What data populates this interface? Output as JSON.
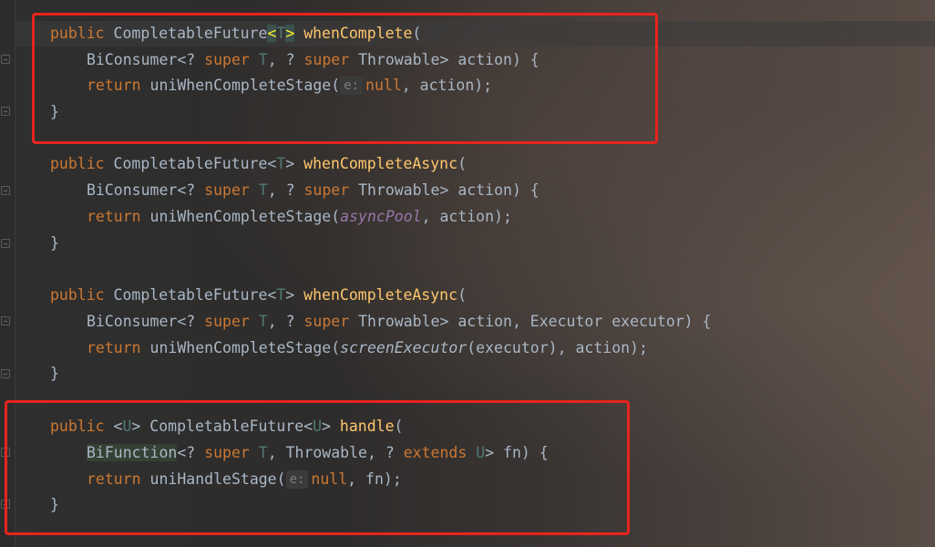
{
  "code": {
    "block1": {
      "sig_kw": "public",
      "sig_type": "CompletableFuture",
      "sig_lt": "<",
      "sig_t": "T",
      "sig_gt": ">",
      "sig_name": "whenComplete",
      "sig_paren": "(",
      "p_type": "BiConsumer<?",
      "p_super1": "super",
      "p_t": "T",
      "p_comma": ", ?",
      "p_super2": "super",
      "p_rest": "Throwable> action) {",
      "ret_kw": "return",
      "ret_call": "uniWhenCompleteStage(",
      "ret_hint": "e:",
      "ret_null": "null",
      "ret_tail": ", action);",
      "close": "}"
    },
    "block2": {
      "sig_kw": "public",
      "sig_type": "CompletableFuture<",
      "sig_t": "T",
      "sig_gt": ">",
      "sig_name": "whenCompleteAsync",
      "sig_paren": "(",
      "p_type": "BiConsumer<?",
      "p_super1": "super",
      "p_t": "T",
      "p_comma": ", ?",
      "p_super2": "super",
      "p_rest": "Throwable> action) {",
      "ret_kw": "return",
      "ret_call": "uniWhenCompleteStage(",
      "ret_arg": "asyncPool",
      "ret_tail": ", action);",
      "close": "}"
    },
    "block3": {
      "sig_kw": "public",
      "sig_type": "CompletableFuture<",
      "sig_t": "T",
      "sig_gt": ">",
      "sig_name": "whenCompleteAsync",
      "sig_paren": "(",
      "p_type": "BiConsumer<?",
      "p_super1": "super",
      "p_t": "T",
      "p_comma": ", ?",
      "p_super2": "super",
      "p_rest": "Throwable> action, Executor executor) {",
      "ret_kw": "return",
      "ret_call": "uniWhenCompleteStage(",
      "ret_arg": "screenExecutor",
      "ret_tail": "(executor), action);",
      "close": "}"
    },
    "block4": {
      "sig_kw": "public",
      "sig_lt": "<",
      "sig_u": "U",
      "sig_gt": ">",
      "sig_type": "CompletableFuture<",
      "sig_u2": "U",
      "sig_gt2": ">",
      "sig_name": "handle",
      "sig_paren": "(",
      "p_type": "BiFunction",
      "p_open": "<?",
      "p_super": "super",
      "p_t": "T",
      "p_mid": ", Throwable, ?",
      "p_extends": "extends",
      "p_u": "U",
      "p_rest": "> fn) {",
      "ret_kw": "return",
      "ret_call": "uniHandleStage(",
      "ret_hint": "e:",
      "ret_null": "null",
      "ret_tail": ", fn);",
      "close": "}"
    }
  },
  "colors": {
    "keyword": "#cc7832",
    "method": "#ffc66d",
    "type_param": "#507874",
    "static_field": "#9876aa",
    "default_text": "#a9b7c6",
    "annotation_box": "#e8241d"
  }
}
